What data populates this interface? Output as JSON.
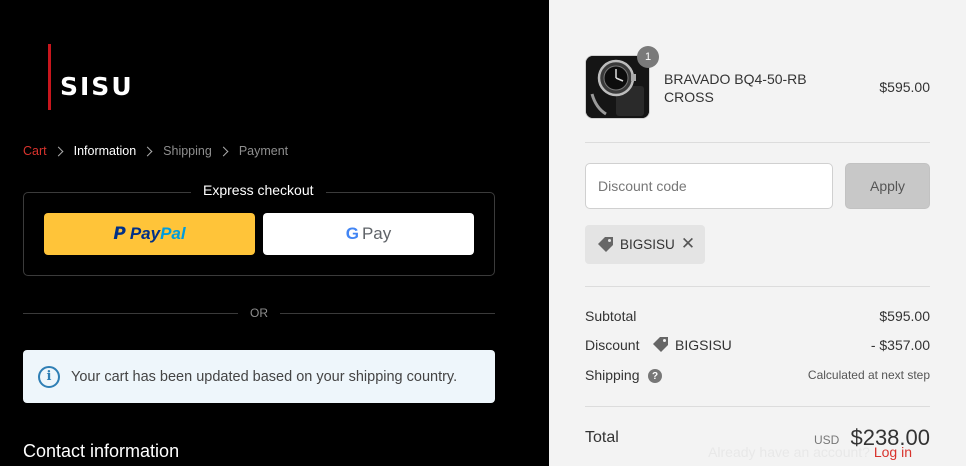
{
  "brand": {
    "logo_text": "SISU",
    "accent_color": "#c8161d"
  },
  "breadcrumb": [
    {
      "label": "Cart",
      "state": "link-red"
    },
    {
      "label": "Information",
      "state": "current"
    },
    {
      "label": "Shipping",
      "state": "upcoming"
    },
    {
      "label": "Payment",
      "state": "upcoming"
    }
  ],
  "express": {
    "title": "Express checkout",
    "paypal": {
      "pay": "Pay",
      "pal": "Pal",
      "bg": "#ffc439"
    },
    "gpay": {
      "g": "G",
      "pay": "Pay"
    },
    "or": "OR"
  },
  "notice": {
    "icon": "info-icon",
    "text": "Your cart has been updated based on your shipping country."
  },
  "contact": {
    "title": "Contact information",
    "account_prompt": "Already have an account?",
    "login": "Log in"
  },
  "order": {
    "item": {
      "qty": "1",
      "name": "BRAVADO BQ4-50-RB CROSS",
      "price": "$595.00"
    },
    "discount_placeholder": "Discount code",
    "apply_label": "Apply",
    "applied_code": "BIGSISU",
    "subtotal_label": "Subtotal",
    "subtotal_value": "$595.00",
    "discount_label": "Discount",
    "discount_code": "BIGSISU",
    "discount_value": "- $357.00",
    "shipping_label": "Shipping",
    "shipping_value": "Calculated at next step",
    "total_label": "Total",
    "currency": "USD",
    "total_value": "$238.00"
  }
}
